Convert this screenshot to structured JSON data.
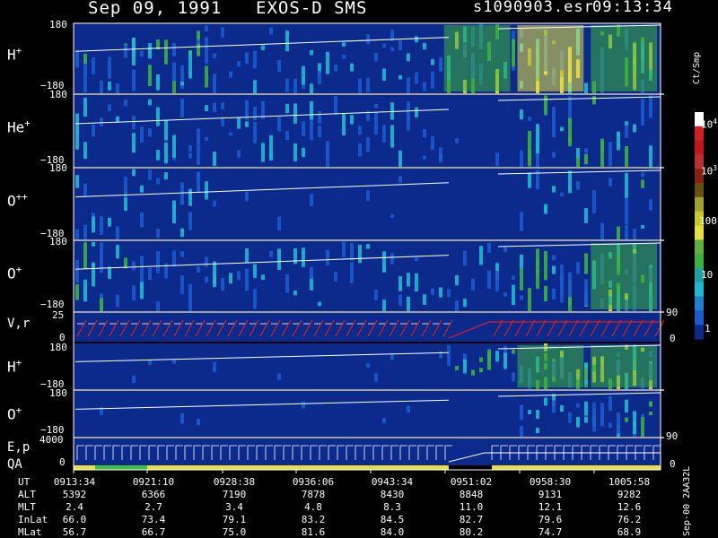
{
  "header": {
    "date": "Sep 09, 1991",
    "instrument": "EXOS-D SMS",
    "filename": "s1090903.esr",
    "time": "09:13:34"
  },
  "colorbar": {
    "unit": "Ct/Smp",
    "ticks": [
      {
        "base": "10",
        "exp": "4"
      },
      {
        "base": "10",
        "exp": "3"
      },
      {
        "base": "100",
        "exp": ""
      },
      {
        "base": "10",
        "exp": ""
      },
      {
        "base": "1",
        "exp": ""
      }
    ]
  },
  "panels": [
    {
      "ion": "H",
      "charge": "+",
      "ytop": "180",
      "ybot": "−180"
    },
    {
      "ion": "He",
      "charge": "+",
      "ytop": "180",
      "ybot": "−180"
    },
    {
      "ion": "O",
      "charge": "++",
      "ytop": "180",
      "ybot": "−180"
    },
    {
      "ion": "O",
      "charge": "+",
      "ytop": "180",
      "ybot": "−180"
    },
    {
      "ion": "V,r",
      "charge": "",
      "ytop": "25",
      "ybot": "0",
      "rtop": "90",
      "rbot": "0"
    },
    {
      "ion": "H",
      "charge": "+",
      "ytop": "180",
      "ybot": "−180"
    },
    {
      "ion": "O",
      "charge": "+",
      "ytop": "180",
      "ybot": "−180",
      "rbot": "90"
    },
    {
      "ion": "E,p",
      "charge": "",
      "ytop": "4000",
      "ybot": "0",
      "rbot": "0",
      "qa": "QA"
    }
  ],
  "footer": {
    "rows": [
      {
        "label": "UT",
        "values": [
          "0913:34",
          "0921:10",
          "0928:38",
          "0936:06",
          "0943:34",
          "0951:02",
          "0958:30",
          "1005:58"
        ]
      },
      {
        "label": "ALT",
        "values": [
          "5392",
          "6366",
          "7190",
          "7878",
          "8430",
          "8848",
          "9131",
          "9282"
        ]
      },
      {
        "label": "MLT",
        "values": [
          "2.4",
          "2.7",
          "3.4",
          "4.8",
          "8.3",
          "11.0",
          "12.1",
          "12.6"
        ]
      },
      {
        "label": "InLat",
        "values": [
          "66.0",
          "73.4",
          "79.1",
          "83.2",
          "84.5",
          "82.7",
          "79.6",
          "76.2"
        ]
      },
      {
        "label": "MLat",
        "values": [
          "56.7",
          "66.7",
          "75.0",
          "81.6",
          "84.0",
          "80.2",
          "74.7",
          "68.9"
        ]
      }
    ],
    "stamp": "Sep-00  2AA32L"
  },
  "colors": {
    "background": "#000000",
    "panel_background": "#0c2a8c",
    "blue": "#1a5acc",
    "cyan": "#20b8d0",
    "green": "#3cb03c",
    "yellow": "#e8e040",
    "olive": "#a0a030",
    "red": "#d02020",
    "vel_line": "#e02020",
    "qa_yellow": "#e8e040",
    "qa_green": "#40c040"
  },
  "chart_data": {
    "type": "heatmap",
    "title": "Sep 09, 1991   EXOS-D SMS",
    "xlabel": "UT",
    "x": [
      "0913:34",
      "0921:10",
      "0928:38",
      "0936:06",
      "0943:34",
      "0951:02",
      "0958:30",
      "1005:58"
    ],
    "colorbar_label": "Ct/Smp",
    "colorbar_range": [
      1,
      10000
    ],
    "log_color_scale": true,
    "series": [
      {
        "name": "H+",
        "ylim": [
          -180,
          180
        ],
        "intensity_by_segment": [
          2,
          2,
          1,
          1,
          1,
          3,
          4,
          3
        ]
      },
      {
        "name": "He+",
        "ylim": [
          -180,
          180
        ],
        "intensity_by_segment": [
          1,
          1,
          1,
          1,
          1,
          0,
          2,
          2
        ]
      },
      {
        "name": "O++",
        "ylim": [
          -180,
          180
        ],
        "intensity_by_segment": [
          1,
          1,
          0,
          0,
          0,
          0,
          1,
          2
        ]
      },
      {
        "name": "O+",
        "ylim": [
          -180,
          180
        ],
        "intensity_by_segment": [
          2,
          1,
          1,
          1,
          1,
          1,
          2,
          3
        ]
      },
      {
        "name": "V,r",
        "ylim": [
          0,
          25
        ],
        "right_ylim": [
          0,
          90
        ]
      },
      {
        "name": "H+",
        "ylim": [
          -180,
          180
        ],
        "intensity_by_segment": [
          0,
          0,
          0,
          0,
          0,
          2,
          3,
          3
        ]
      },
      {
        "name": "O+",
        "ylim": [
          -180,
          180
        ],
        "intensity_by_segment": [
          0,
          0,
          0,
          0,
          0,
          0,
          1,
          2
        ]
      },
      {
        "name": "E,p",
        "ylim": [
          0,
          4000
        ],
        "right_ylim": [
          0,
          0
        ]
      }
    ]
  }
}
